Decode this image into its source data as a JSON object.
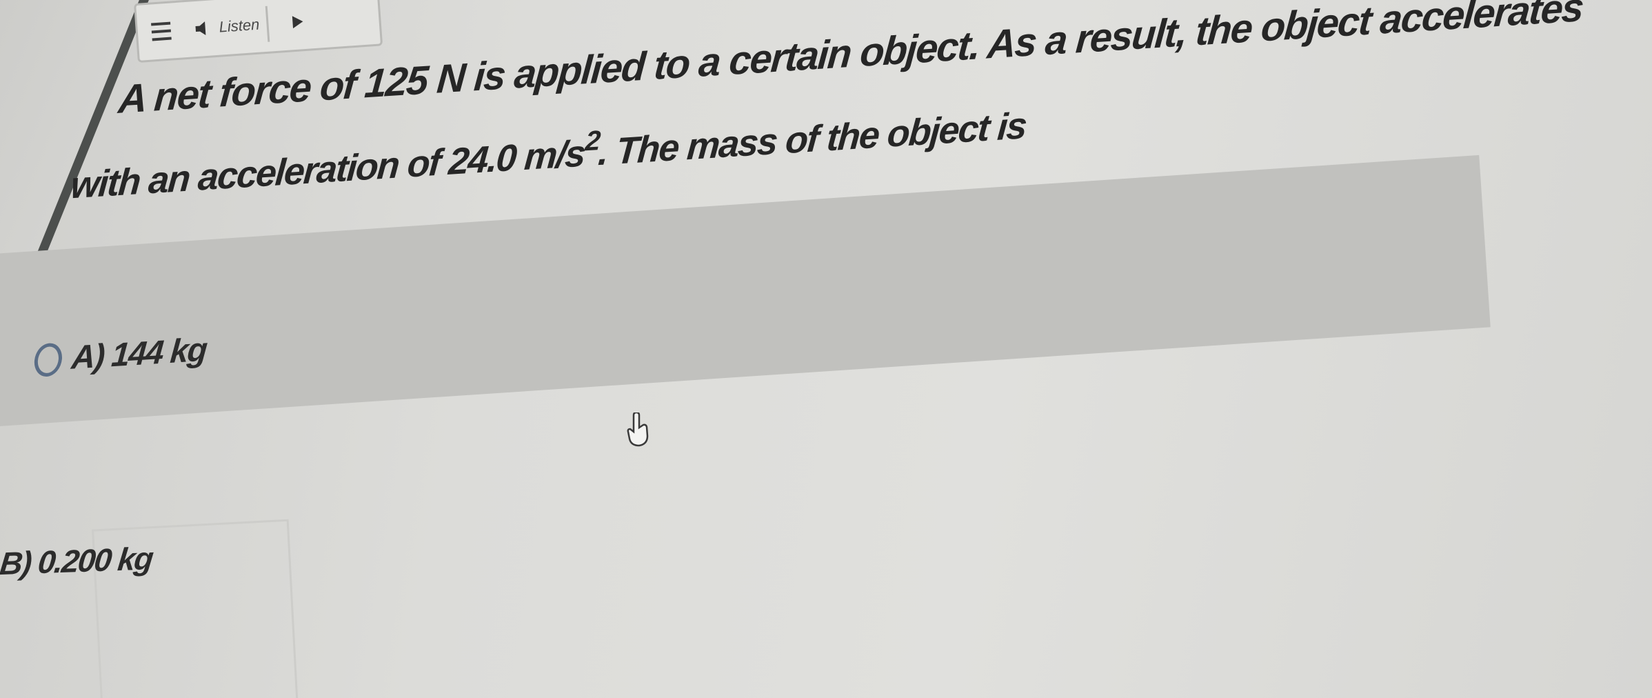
{
  "toolbar": {
    "menu_icon": "hamburger-menu-icon",
    "speaker_icon": "speaker-icon",
    "listen_label": "Listen",
    "play_icon": "play-icon"
  },
  "question": {
    "line1": "A net force of 125 N is applied to a certain object. As a result, the object accelerates",
    "line2_prefix": "with an acceleration of 24.0 m/s",
    "line2_sup": "2",
    "line2_suffix": ". The mass of the object is"
  },
  "options": [
    {
      "label": "A) 144 kg",
      "selected": false
    },
    {
      "label": "B) 0.200 kg",
      "selected": false
    }
  ],
  "colors": {
    "highlight_band": "#c1c1be",
    "radio_border": "#5a6d86",
    "left_rail_border": "#4c4f4d",
    "text": "#262626"
  },
  "cursor_icon": "hand-pointer-cursor-icon"
}
